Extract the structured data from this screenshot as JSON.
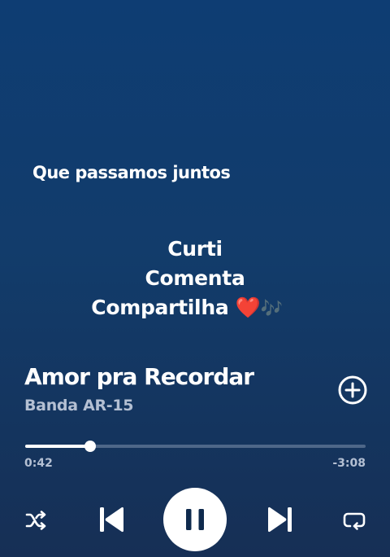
{
  "lyrics": {
    "current_line": "Que passamos juntos"
  },
  "overlay": {
    "line1": "Curti",
    "line2": "Comenta",
    "line3": "Compartilha",
    "heart_emoji": "❤️",
    "notes_emoji": "🎶"
  },
  "track": {
    "title": "Amor pra Recordar",
    "artist": "Banda AR-15"
  },
  "progress": {
    "elapsed": "0:42",
    "remaining": "-3:08",
    "fraction": 0.19
  },
  "controls": {
    "shuffle_icon": "shuffle-icon",
    "previous_icon": "skip-previous-icon",
    "play_pause_icon": "pause-icon",
    "next_icon": "skip-next-icon",
    "repeat_icon": "repeat-icon",
    "add_icon": "add-circle-icon"
  },
  "colors": {
    "background_top": "#0e3d73",
    "background_bottom": "#162f55",
    "secondary_text": "#b4c0d3",
    "track_rail": "#4e6788",
    "heart": "#e0222c"
  }
}
